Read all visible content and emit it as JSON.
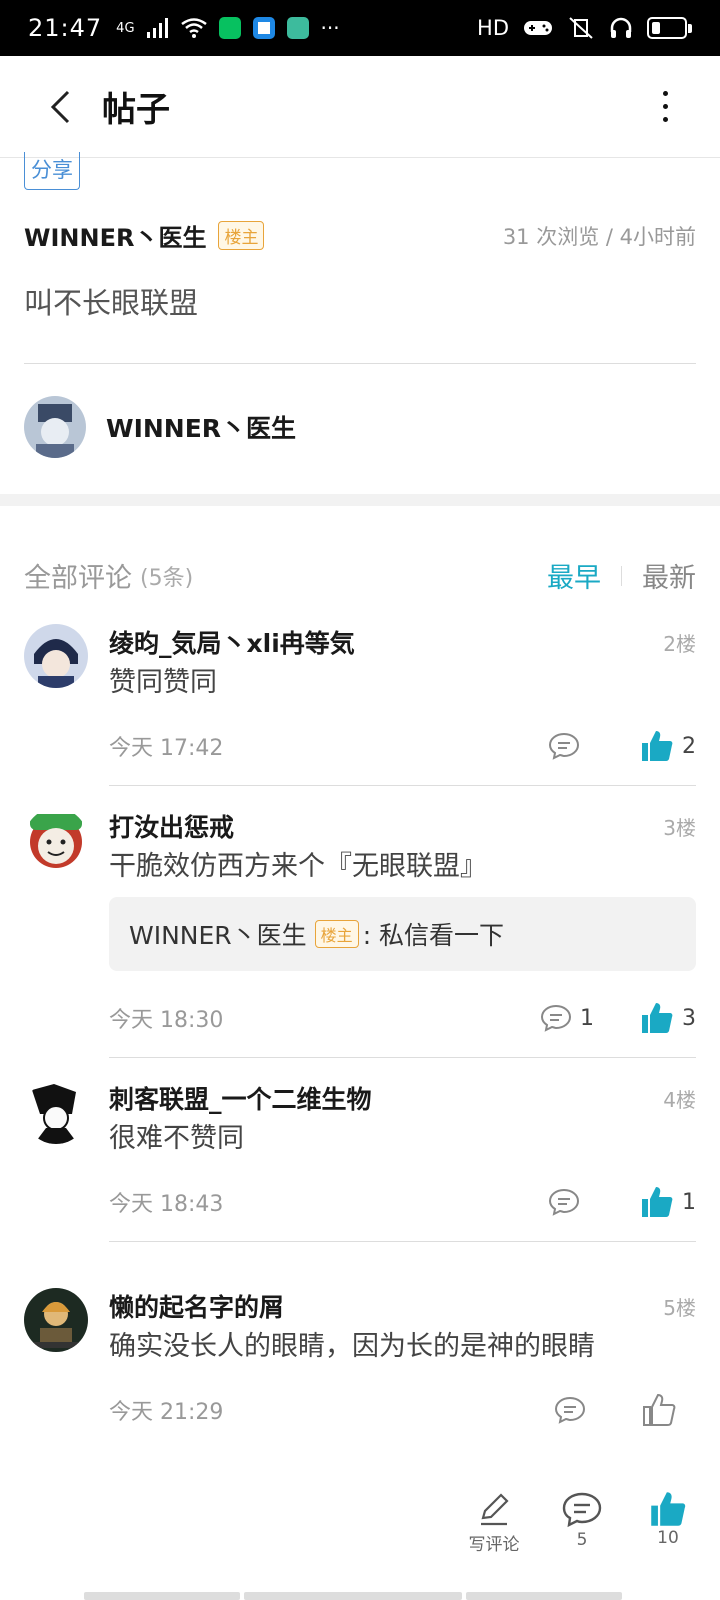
{
  "status_bar": {
    "time": "21:47",
    "net": "4G",
    "right_text": "HD"
  },
  "header": {
    "title": "帖子"
  },
  "post": {
    "tag": "分享",
    "author": "WINNER丶医生",
    "author_badge": "楼主",
    "meta": "31 次浏览 / 4小时前",
    "content": "叫不长眼联盟",
    "user_name": "WINNER丶医生"
  },
  "comments_section": {
    "title": "全部评论",
    "count": "(5条)",
    "sort_earliest": "最早",
    "sort_latest": "最新"
  },
  "comments": [
    {
      "name": "绫昀_気局丶xli冉等気",
      "floor": "2楼",
      "text": "赞同赞同",
      "time": "今天 17:42",
      "likes": "2"
    },
    {
      "name": "打汝出惩戒",
      "floor": "3楼",
      "text": "干脆效仿西方来个『无眼联盟』",
      "time": "今天 18:30",
      "reply_author": "WINNER丶医生",
      "reply_badge": "楼主",
      "reply_text": ": 私信看一下",
      "replies": "1",
      "likes": "3"
    },
    {
      "name": "刺客联盟_一个二维生物",
      "floor": "4楼",
      "text": "很难不赞同",
      "time": "今天 18:43",
      "likes": "1"
    },
    {
      "name": "懒的起名字的屑",
      "floor": "5楼",
      "text": "确实没长人的眼睛，因为长的是神的眼睛",
      "time": "今天 21:29"
    }
  ],
  "bottom_bar": {
    "write_label": "写评论",
    "comment_count": "5",
    "like_count": "10"
  },
  "colors": {
    "accent": "#1aa9c4",
    "badge": "#e8a43a",
    "tag": "#4a8fd6"
  }
}
